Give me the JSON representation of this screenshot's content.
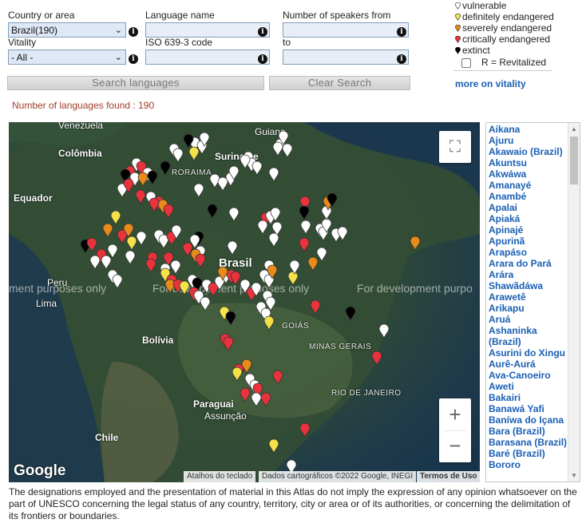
{
  "filters": {
    "country_label": "Country or area",
    "country_value": "Brazil(190)",
    "language_label": "Language name",
    "language_value": "",
    "speakers_from_label": "Number of speakers from",
    "speakers_from_value": "",
    "vitality_label": "Vitality",
    "vitality_value": "- All -",
    "iso_label": "ISO 639-3 code",
    "iso_value": "",
    "speakers_to_label": "to",
    "speakers_to_value": "",
    "search_button": "Search languages",
    "clear_button": "Clear Search"
  },
  "legend": {
    "items": [
      {
        "label": "vulnerable",
        "color": "#ffffff"
      },
      {
        "label": "definitely endangered",
        "color": "#f5e14a"
      },
      {
        "label": "severely endangered",
        "color": "#e88b1a"
      },
      {
        "label": "critically endangered",
        "color": "#e8323c"
      },
      {
        "label": "extinct",
        "color": "#000000"
      }
    ],
    "revitalized_label": "R = Revitalized",
    "more_link": "more on vitality"
  },
  "result_count": "Number of languages found : 190",
  "map": {
    "labels": {
      "venezuela": "Venezuela",
      "colombia": "Colômbia",
      "guyana": "Guiana",
      "suriname": "Suriname",
      "roraima": "RORAIMA",
      "ecuador": "Equador",
      "brasil": "Brasil",
      "peru": "Peru",
      "lima": "Lima",
      "goias": "GOIÁS",
      "minas": "MINAS GERAIS",
      "bolivia": "Bolívia",
      "riodejaneiro": "RIO DE JANEIRO",
      "paraguai": "Paraguai",
      "assuncao": "Assunção",
      "chile": "Chile"
    },
    "watermark_left": "ment purposes only",
    "watermark_mid": "For development purposes only",
    "watermark_right": "For development purpo",
    "attribution_keyboard": "Atalhos do teclado",
    "attribution_data": "Dados cartográficos ©2022 Google, INEGI",
    "attribution_terms": "Termos de Uso",
    "google": "Google",
    "zoom_in": "+",
    "zoom_out": "−"
  },
  "languages": [
    "Aikana",
    "Ajuru",
    "Akawaio (Brazil)",
    "Akuntsu",
    "Akwáwa",
    "Amanayé",
    "Anambé",
    "Apalai",
    "Apiaká",
    "Apinajé",
    "Apurinã",
    "Arapáso",
    "Arara do Pará",
    "Arára",
    "Shawãdáwa",
    "Arawetê",
    "Arikapu",
    "Aruá",
    "Ashaninka (Brazil)",
    "Asurini do Xingu",
    "Aurê-Aurá",
    "Ava-Canoeiro",
    "Aweti",
    "Bakairi",
    "Banawá Yafi",
    "Baníwa do Içana",
    "Bara (Brazil)",
    "Barasana (Brazil)",
    "Baré (Brazil)",
    "Bororo"
  ],
  "disclaimer": "The designations employed and the presentation of material in this Atlas do not imply the expression of any opinion whatsoever on the part of UNESCO concerning the legal status of any country, territory, city or area or of its authorities, or concerning the delimitation of its frontiers or boundaries."
}
